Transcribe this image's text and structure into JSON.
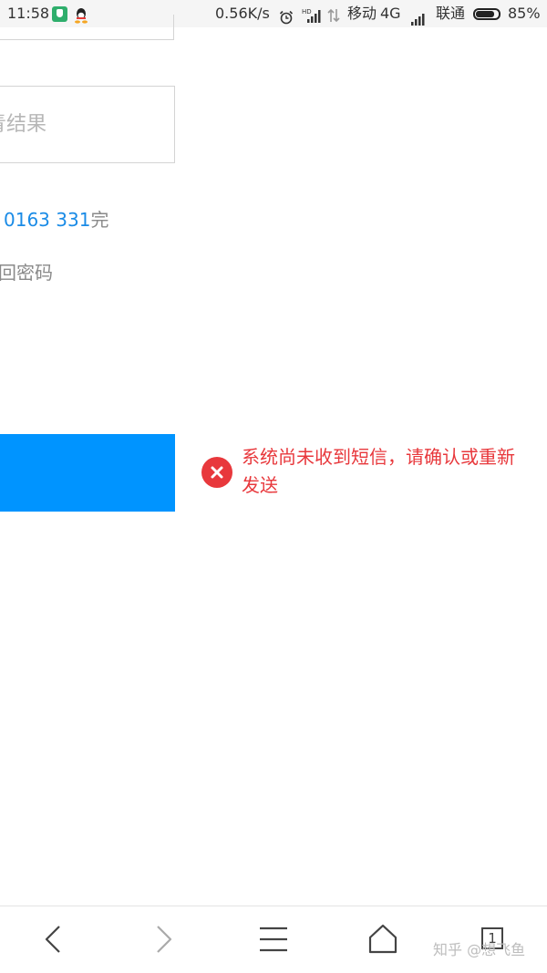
{
  "status_bar": {
    "time": "11:58",
    "network_speed": "0.56K/s",
    "carrier_1": "移动",
    "network_type": "4G",
    "carrier_2": "联通",
    "battery_percent": "85%",
    "battery_level": 0.85,
    "icons": [
      "shield-app-icon",
      "qq-icon",
      "alarm-icon",
      "hd-signal-icon",
      "data-arrows-icon",
      "signal-icon",
      "battery-icon"
    ]
  },
  "form": {
    "result_placeholder": "青结果",
    "phone_prefix": "0163 331",
    "phone_suffix": "完",
    "recover_link": "回密码"
  },
  "error": {
    "icon": "error-circle-icon",
    "message": "系统尚未收到短信，请确认或重新发送",
    "color": "#e8383c"
  },
  "nav": {
    "back": "back-icon",
    "forward": "forward-icon",
    "menu": "menu-icon",
    "home": "home-icon",
    "tabs_count": "1"
  },
  "watermark": "知乎 @想飞鱼",
  "colors": {
    "accent": "#0094ff",
    "link": "#1a8be6",
    "error": "#e8383c"
  }
}
